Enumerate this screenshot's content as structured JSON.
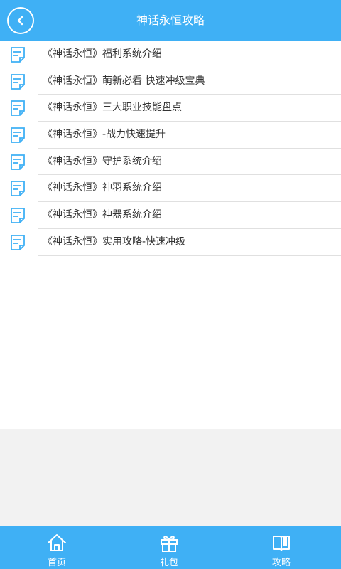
{
  "header": {
    "title": "神话永恒攻略",
    "back_icon": "back-arrow-icon"
  },
  "list": {
    "items": [
      {
        "label": "《神话永恒》福利系统介绍"
      },
      {
        "label": "《神话永恒》萌新必看 快速冲级宝典"
      },
      {
        "label": "《神话永恒》三大职业技能盘点"
      },
      {
        "label": "《神话永恒》-战力快速提升"
      },
      {
        "label": "《神话永恒》守护系统介绍"
      },
      {
        "label": "《神话永恒》神羽系统介绍"
      },
      {
        "label": "《神话永恒》神器系统介绍"
      },
      {
        "label": "《神话永恒》实用攻略-快速冲级"
      }
    ]
  },
  "bottom_nav": {
    "items": [
      {
        "label": "首页",
        "icon": "home-icon"
      },
      {
        "label": "礼包",
        "icon": "gift-icon"
      },
      {
        "label": "攻略",
        "icon": "book-icon"
      }
    ]
  },
  "colors": {
    "accent": "#3fb0f5",
    "text": "#333333",
    "divider": "#e0e0e0",
    "background": "#f2f2f2"
  }
}
